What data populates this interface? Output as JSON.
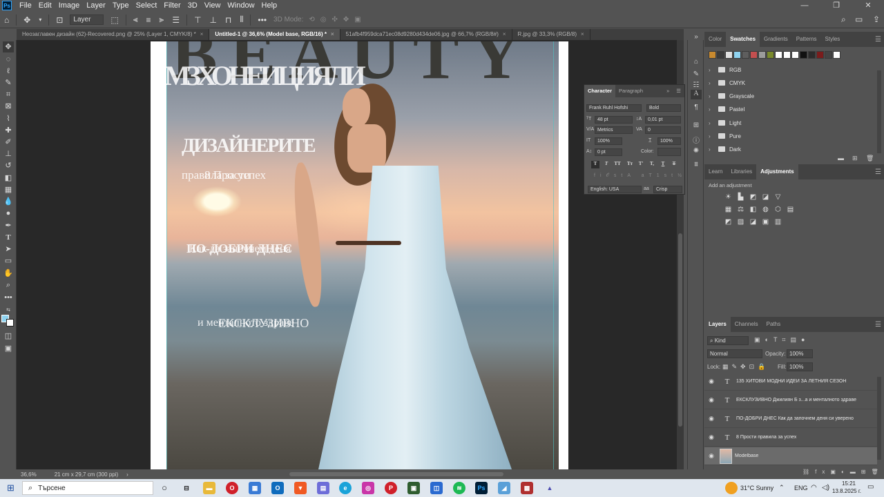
{
  "menubar": {
    "items": [
      "File",
      "Edit",
      "Image",
      "Layer",
      "Type",
      "Select",
      "Filter",
      "3D",
      "View",
      "Window",
      "Help"
    ],
    "app_icon": "Ps"
  },
  "optionsbar": {
    "auto_select_value": "Layer",
    "mode_3d_label": "3D Mode:"
  },
  "tabs": [
    {
      "label": "Неозаглавен дизайн (62)-Recovered.png @ 25% (Layer 1, CMYK/8) *",
      "active": false
    },
    {
      "label": "Untitled-1 @ 36,6% (Model base, RGB/16) *",
      "active": true
    },
    {
      "label": "51afb4f959dca71ec08d9280d434de06.jpg @ 66,7% (RGB/8#)",
      "active": false
    },
    {
      "label": "R.jpg @ 33,3% (RGB/8)",
      "active": false
    }
  ],
  "canvas": {
    "headline": "BEAUTY",
    "overlays": [
      {
        "text": "МЗХОНЕИЦИЯЛИ",
        "cls": "b"
      },
      {
        "text": "ДИЗАЙНЕРИТЕ",
        "cls": "b"
      },
      {
        "text": "правила за успех",
        "cls": ""
      },
      {
        "text": "8 Прости",
        "cls": ""
      },
      {
        "text": "ПО-ДОБРИ ДНЕС",
        "cls": "b"
      },
      {
        "text": "Как да започнем деня",
        "cls": ""
      },
      {
        "text": "и менталното здраве",
        "cls": ""
      },
      {
        "text": "ЕКСКЛУЗИВНО",
        "cls": ""
      }
    ]
  },
  "statusbar": {
    "zoom": "36,6%",
    "doc_size": "21 cm x 29,7 cm (300 ppi)"
  },
  "swatches_panel": {
    "tabs": [
      "Color",
      "Swatches",
      "Gradients",
      "Patterns",
      "Styles"
    ],
    "active_tab": "Swatches",
    "colors": [
      "#c98a2f",
      "#3b3b3b",
      "#e0e0e0",
      "#8fd3f0",
      "#5e5e5e",
      "#c44f4f",
      "#9c9c9c",
      "#7a8a2c",
      "#ffffff",
      "#ffffff",
      "#ffffff",
      "#111111",
      "#2c2c2c",
      "#7a1c1c",
      "#444444",
      "#ffffff"
    ],
    "folders": [
      "RGB",
      "CMYK",
      "Grayscale",
      "Pastel",
      "Light",
      "Pure",
      "Dark"
    ]
  },
  "adjustments_panel": {
    "tabs": [
      "Learn",
      "Libraries",
      "Adjustments"
    ],
    "active_tab": "Adjustments",
    "add_label": "Add an adjustment"
  },
  "character_panel": {
    "tabs": [
      "Character",
      "Paragraph"
    ],
    "font_family": "Frank Ruhl Hofshi",
    "font_style": "Bold",
    "font_size": "48 pt",
    "leading": "0,01 pt",
    "kerning": "Metrics",
    "tracking": "0",
    "vertical_scale": "100%",
    "horizontal_scale": "100%",
    "baseline_shift": "0 pt",
    "color_label": "Color:",
    "language": "English: USA",
    "antialias": "Crisp",
    "aa_prefix": "aa",
    "type_buttons": [
      "T",
      "T",
      "TT",
      "Tт",
      "T'",
      "T,",
      "T",
      "T"
    ]
  },
  "layers_panel": {
    "tabs": [
      "Layers",
      "Channels",
      "Paths"
    ],
    "active_tab": "Layers",
    "filter_kind": "Kind",
    "blend_mode": "Normal",
    "opacity_label": "Opacity:",
    "opacity_value": "100%",
    "lock_label": "Lock:",
    "fill_label": "Fill:",
    "fill_value": "100%",
    "layers": [
      {
        "name": "135 ХИТОВИ МОДНИ ИДЕИ ЗА ЛЕТНИЯ СЕЗОН",
        "type": "T",
        "selected": false
      },
      {
        "name": "ЕКСКЛУЗИВНО Джилиян Б з...а и менталното здраве",
        "type": "T",
        "selected": false
      },
      {
        "name": "ПО-ДОБРИ ДНЕС Как да започнем деня си уверено",
        "type": "T",
        "selected": false
      },
      {
        "name": "8 Прости правила за успех",
        "type": "T",
        "selected": false
      },
      {
        "name": "Modelbase",
        "type": "image",
        "selected": true
      }
    ]
  },
  "taskbar": {
    "search_placeholder": "Търсене",
    "weather": "31°C  Sunny",
    "language": "ENG",
    "time": "15:21",
    "date": "13.8.2025 г."
  }
}
